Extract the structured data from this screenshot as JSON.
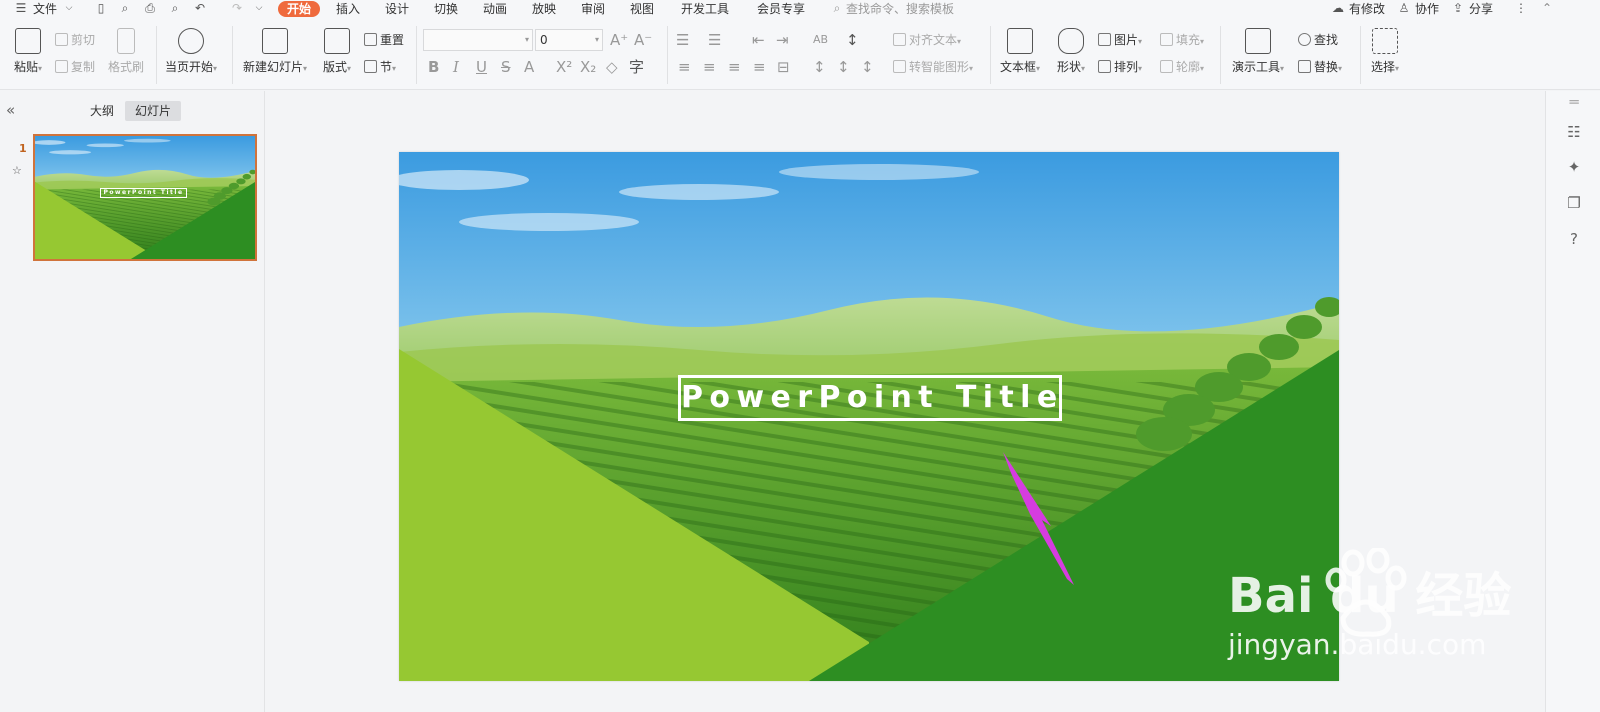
{
  "menubar": {
    "file_label": "文件",
    "tabs": [
      "开始",
      "插入",
      "设计",
      "切换",
      "动画",
      "放映",
      "审阅",
      "视图",
      "开发工具",
      "会员专享"
    ],
    "search_placeholder": "查找命令、搜索模板",
    "right_actions": [
      "有修改",
      "协作",
      "分享"
    ]
  },
  "ribbon": {
    "paste": "粘贴",
    "cut": "剪切",
    "copy": "复制",
    "format_painter": "格式刷",
    "start_from_current": "当页开始",
    "new_slide": "新建幻灯片",
    "layout": "版式",
    "reset": "重置",
    "section": "节",
    "font_size_value": "0",
    "align_text": "对齐文本",
    "convert_smartart": "转智能图形",
    "text_box": "文本框",
    "shape": "形状",
    "picture": "图片",
    "arrange": "排列",
    "fill": "填充",
    "outline": "轮廓",
    "presentation_tools": "演示工具",
    "find": "查找",
    "replace": "替换",
    "select": "选择"
  },
  "left_panel": {
    "tabs": [
      "大纲",
      "幻灯片"
    ],
    "slide_number": "1",
    "thumb_title": "PowerPoint Title"
  },
  "slide": {
    "title": "PowerPoint Title"
  },
  "watermark": {
    "brand": "Bai du 经验",
    "url": "jingyan.baidu.com"
  },
  "colors": {
    "accent_tab": "#ef6a3d",
    "thumb_border": "#d0733b",
    "arrow": "#d63ce0",
    "light_green": "#96c832",
    "dark_green": "#2d8e22"
  }
}
